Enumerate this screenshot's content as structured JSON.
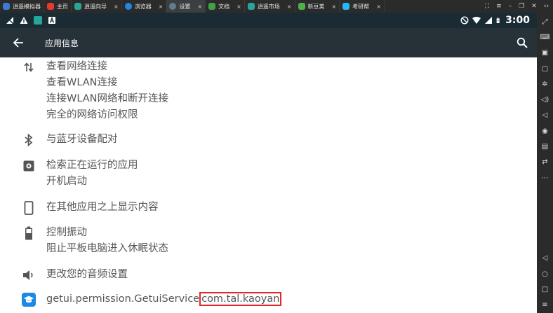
{
  "tabs": [
    {
      "label": "逍遥模拟器",
      "color": "#3a7bd5",
      "close": "",
      "active": false
    },
    {
      "label": "主页",
      "color": "#e53935",
      "close": "",
      "active": false
    },
    {
      "label": "逍遥向导",
      "color": "#26a69a",
      "close": "×",
      "active": false
    },
    {
      "label": "浏览器",
      "color": "#1e88e5",
      "close": "×",
      "active": false
    },
    {
      "label": "设置",
      "color": "#607d8b",
      "close": "×",
      "active": true
    },
    {
      "label": "文档",
      "color": "#43a047",
      "close": "×",
      "active": false
    },
    {
      "label": "逍遥市场",
      "color": "#26a69a",
      "close": "×",
      "active": false
    },
    {
      "label": "新豆荚",
      "color": "#4caf50",
      "close": "×",
      "active": false
    },
    {
      "label": "考研帮",
      "color": "#29b6f6",
      "close": "×",
      "active": false
    }
  ],
  "statusbar": {
    "time": "3:00"
  },
  "toolbar": {
    "title": "应用信息"
  },
  "permissions": [
    {
      "icon": "network-arrows-icon",
      "lines": [
        "查看网络连接",
        "查看WLAN连接",
        "连接WLAN网络和断开连接",
        "完全的网络访问权限"
      ]
    },
    {
      "icon": "bluetooth-icon",
      "lines": [
        "与蓝牙设备配对"
      ]
    },
    {
      "icon": "settings-gear-icon",
      "lines": [
        "检索正在运行的应用",
        "开机启动"
      ]
    },
    {
      "icon": "phone-icon",
      "lines": [
        "在其他应用之上显示内容"
      ]
    },
    {
      "icon": "battery-icon",
      "lines": [
        "控制振动",
        "阻止平板电脑进入休眠状态"
      ]
    },
    {
      "icon": "volume-icon",
      "lines": [
        "更改您的音频设置"
      ]
    },
    {
      "icon": "app-cap-icon",
      "line_prefix": "getui.permission.GetuiService",
      "line_highlight": "com.tal.kaoyan"
    }
  ],
  "colors": {
    "toolbar": "#263238",
    "statusbar": "#1a2b33",
    "text": "#555555",
    "highlight_border": "#e0282e",
    "app_icon": "#1e88e5"
  }
}
